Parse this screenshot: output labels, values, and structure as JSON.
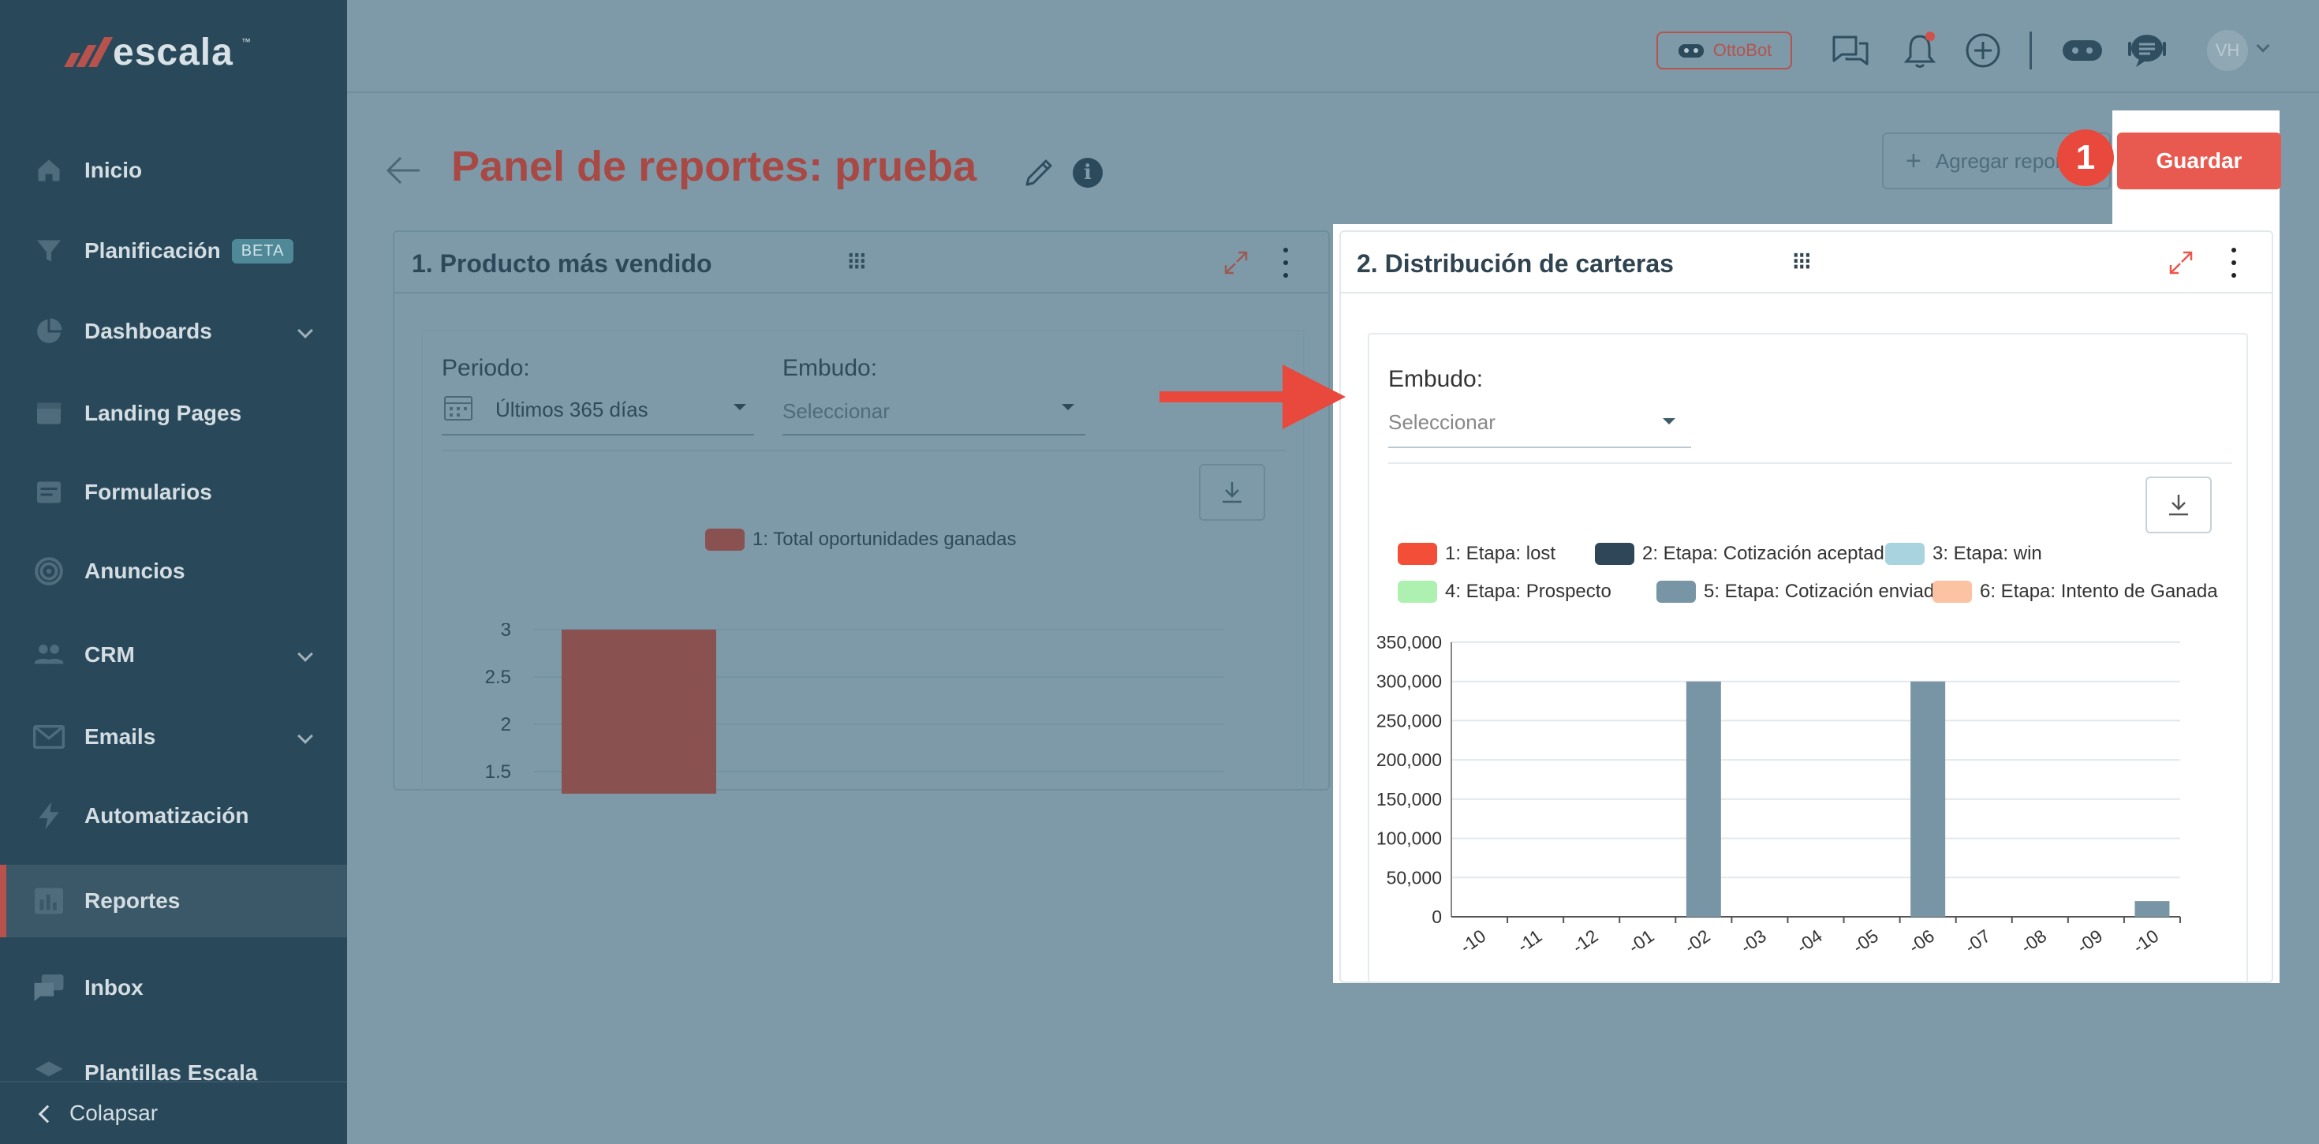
{
  "brand": {
    "name": "escala",
    "tm": "™"
  },
  "sidebar": {
    "items": [
      {
        "label": "Inicio",
        "icon": "home-icon"
      },
      {
        "label": "Planificación",
        "badge": "BETA",
        "icon": "funnel-icon"
      },
      {
        "label": "Dashboards",
        "icon": "pie-chart-icon",
        "expandable": true
      },
      {
        "label": "Landing Pages",
        "icon": "browser-window-icon"
      },
      {
        "label": "Formularios",
        "icon": "form-icon"
      },
      {
        "label": "Anuncios",
        "icon": "target-icon"
      },
      {
        "label": "CRM",
        "icon": "people-icon",
        "expandable": true
      },
      {
        "label": "Emails",
        "icon": "envelope-icon",
        "expandable": true
      },
      {
        "label": "Automatización",
        "icon": "lightning-icon"
      },
      {
        "label": "Reportes",
        "icon": "report-icon",
        "active": true
      },
      {
        "label": "Inbox",
        "icon": "chat-bubbles-icon"
      },
      {
        "label": "Plantillas Escala",
        "icon": "layers-icon",
        "expandable": true
      }
    ],
    "collapse_label": "Colapsar"
  },
  "topbar": {
    "ottobot_label": "OttoBot",
    "avatar_initials": "VH",
    "icons": [
      "chat-icon",
      "bell-icon",
      "plus-circle-icon",
      "gamepad-icon",
      "support-chat-icon"
    ]
  },
  "header": {
    "title": "Panel de reportes: prueba",
    "add_report_label": "Agregar reporte",
    "save_label": "Guardar",
    "step_number": "1"
  },
  "card1": {
    "title": "1. Producto más vendido",
    "period_label": "Periodo:",
    "period_value": "Últimos 365 días",
    "funnel_label": "Embudo:",
    "funnel_placeholder": "Seleccionar",
    "legend": "1: Total oportunidades ganadas",
    "y_ticks": [
      "3",
      "2.5",
      "2",
      "1.5"
    ]
  },
  "card2": {
    "title": "2. Distribución de carteras",
    "funnel_label": "Embudo:",
    "funnel_placeholder": "Seleccionar",
    "legend": [
      {
        "label": "1: Etapa: lost",
        "color": "#f24e38"
      },
      {
        "label": "2: Etapa: Cotización aceptada",
        "color": "#2e4657"
      },
      {
        "label": "3: Etapa: win",
        "color": "#a8d3df"
      },
      {
        "label": "4: Etapa: Prospecto",
        "color": "#aef0b0"
      },
      {
        "label": "5: Etapa: Cotización enviada",
        "color": "#7895a5"
      },
      {
        "label": "6: Etapa: Intento de Ganada",
        "color": "#fcc3a3"
      }
    ]
  },
  "chart_data": [
    {
      "type": "bar",
      "legend": [
        "1: Total oportunidades ganadas"
      ],
      "series": [
        {
          "name": "1: Total oportunidades ganadas",
          "values": [
            3
          ]
        }
      ],
      "y_ticks": [
        3,
        2.5,
        2,
        1.5
      ],
      "color": "#8a5151"
    },
    {
      "type": "bar",
      "categories": [
        "-10",
        "-11",
        "-12",
        "-01",
        "-02",
        "-03",
        "-04",
        "-05",
        "-06",
        "-07",
        "-08",
        "-09",
        "-10"
      ],
      "series": [
        {
          "name": "5: Etapa: Cotización enviada",
          "values": [
            0,
            0,
            0,
            0,
            300000,
            0,
            0,
            0,
            300000,
            0,
            0,
            0,
            20000
          ]
        }
      ],
      "ylim": [
        0,
        350000
      ],
      "y_ticks": [
        "0",
        "50,000",
        "100,000",
        "150,000",
        "200,000",
        "250,000",
        "300,000",
        "350,000"
      ],
      "grid": true
    }
  ]
}
